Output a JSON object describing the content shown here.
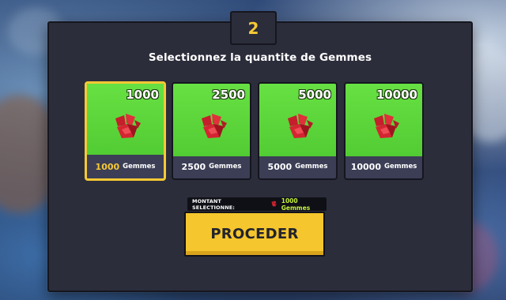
{
  "step": {
    "number": "2"
  },
  "title": "Selectionnez la quantite de Gemmes",
  "cards": [
    {
      "top_amount": "1000",
      "bottom_amount": "1000",
      "unit": "Gemmes",
      "selected": true
    },
    {
      "top_amount": "2500",
      "bottom_amount": "2500",
      "unit": "Gemmes",
      "selected": false
    },
    {
      "top_amount": "5000",
      "bottom_amount": "5000",
      "unit": "Gemmes",
      "selected": false
    },
    {
      "top_amount": "10000",
      "bottom_amount": "10000",
      "unit": "Gemmes",
      "selected": false
    }
  ],
  "selection": {
    "label": "MONTANT SELECTIONNE:",
    "value": "1000 Gemmes",
    "icon": "gem-icon"
  },
  "proceed": {
    "label": "PROCEDER"
  },
  "colors": {
    "panel": "#2c2d3b",
    "card_green": "#5cd93b",
    "accent_yellow": "#f6c935",
    "selection_value": "#c4f03a",
    "gem_red": "#e0303a"
  },
  "icons": {
    "gem": "red-gem-icon"
  }
}
